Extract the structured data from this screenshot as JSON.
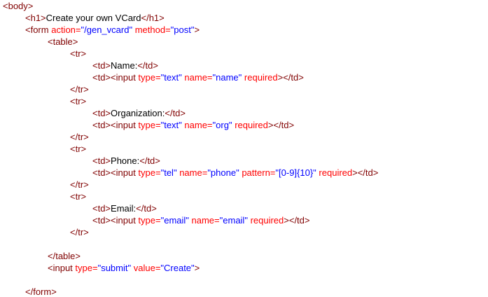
{
  "editor": {
    "lines": [
      {
        "indent": 0,
        "tokens": [
          {
            "t": "tag",
            "v": "<body>"
          }
        ]
      },
      {
        "indent": 1,
        "tokens": [
          {
            "t": "tag",
            "v": "<h1>"
          },
          {
            "t": "txt",
            "v": "Create your own VCard"
          },
          {
            "t": "tag",
            "v": "</h1>"
          }
        ]
      },
      {
        "indent": 1,
        "tokens": [
          {
            "t": "tag",
            "v": "<form "
          },
          {
            "t": "attr",
            "v": "action="
          },
          {
            "t": "val",
            "v": "\"/gen_vcard\""
          },
          {
            "t": "tag",
            "v": " "
          },
          {
            "t": "attr",
            "v": "method="
          },
          {
            "t": "val",
            "v": "\"post\""
          },
          {
            "t": "tag",
            "v": ">"
          }
        ]
      },
      {
        "indent": 2,
        "tokens": [
          {
            "t": "tag",
            "v": "<table>"
          }
        ]
      },
      {
        "indent": 3,
        "tokens": [
          {
            "t": "tag",
            "v": "<tr>"
          }
        ]
      },
      {
        "indent": 4,
        "tokens": [
          {
            "t": "tag",
            "v": "<td>"
          },
          {
            "t": "txt",
            "v": "Name:"
          },
          {
            "t": "tag",
            "v": "</td>"
          }
        ]
      },
      {
        "indent": 4,
        "tokens": [
          {
            "t": "tag",
            "v": "<td><input "
          },
          {
            "t": "attr",
            "v": "type="
          },
          {
            "t": "val",
            "v": "\"text\""
          },
          {
            "t": "tag",
            "v": " "
          },
          {
            "t": "attr",
            "v": "name="
          },
          {
            "t": "val",
            "v": "\"name\""
          },
          {
            "t": "tag",
            "v": " "
          },
          {
            "t": "attr",
            "v": "required"
          },
          {
            "t": "tag",
            "v": "></td>"
          }
        ]
      },
      {
        "indent": 3,
        "tokens": [
          {
            "t": "tag",
            "v": "</tr>"
          }
        ]
      },
      {
        "indent": 3,
        "tokens": [
          {
            "t": "tag",
            "v": "<tr>"
          }
        ]
      },
      {
        "indent": 4,
        "tokens": [
          {
            "t": "tag",
            "v": "<td>"
          },
          {
            "t": "txt",
            "v": "Organization:"
          },
          {
            "t": "tag",
            "v": "</td>"
          }
        ]
      },
      {
        "indent": 4,
        "tokens": [
          {
            "t": "tag",
            "v": "<td><input "
          },
          {
            "t": "attr",
            "v": "type="
          },
          {
            "t": "val",
            "v": "\"text\""
          },
          {
            "t": "tag",
            "v": " "
          },
          {
            "t": "attr",
            "v": "name="
          },
          {
            "t": "val",
            "v": "\"org\""
          },
          {
            "t": "tag",
            "v": " "
          },
          {
            "t": "attr",
            "v": "required"
          },
          {
            "t": "tag",
            "v": "></td>"
          }
        ]
      },
      {
        "indent": 3,
        "tokens": [
          {
            "t": "tag",
            "v": "</tr>"
          }
        ]
      },
      {
        "indent": 3,
        "tokens": [
          {
            "t": "tag",
            "v": "<tr>"
          }
        ]
      },
      {
        "indent": 4,
        "tokens": [
          {
            "t": "tag",
            "v": "<td>"
          },
          {
            "t": "txt",
            "v": "Phone:"
          },
          {
            "t": "tag",
            "v": "</td>"
          }
        ]
      },
      {
        "indent": 4,
        "tokens": [
          {
            "t": "tag",
            "v": "<td><input "
          },
          {
            "t": "attr",
            "v": "type="
          },
          {
            "t": "val",
            "v": "\"tel\""
          },
          {
            "t": "tag",
            "v": " "
          },
          {
            "t": "attr",
            "v": "name="
          },
          {
            "t": "val",
            "v": "\"phone\""
          },
          {
            "t": "tag",
            "v": " "
          },
          {
            "t": "attr",
            "v": "pattern="
          },
          {
            "t": "val",
            "v": "\"[0-9]{10}\""
          },
          {
            "t": "tag",
            "v": " "
          },
          {
            "t": "attr",
            "v": "required"
          },
          {
            "t": "tag",
            "v": "></td>"
          }
        ]
      },
      {
        "indent": 3,
        "tokens": [
          {
            "t": "tag",
            "v": "</tr>"
          }
        ]
      },
      {
        "indent": 3,
        "tokens": [
          {
            "t": "tag",
            "v": "<tr>"
          }
        ]
      },
      {
        "indent": 4,
        "tokens": [
          {
            "t": "tag",
            "v": "<td>"
          },
          {
            "t": "txt",
            "v": "Email:"
          },
          {
            "t": "tag",
            "v": "</td>"
          }
        ]
      },
      {
        "indent": 4,
        "tokens": [
          {
            "t": "tag",
            "v": "<td><input "
          },
          {
            "t": "attr",
            "v": "type="
          },
          {
            "t": "val",
            "v": "\"email\""
          },
          {
            "t": "tag",
            "v": " "
          },
          {
            "t": "attr",
            "v": "name="
          },
          {
            "t": "val",
            "v": "\"email\""
          },
          {
            "t": "tag",
            "v": " "
          },
          {
            "t": "attr",
            "v": "required"
          },
          {
            "t": "tag",
            "v": "></td>"
          }
        ]
      },
      {
        "indent": 3,
        "tokens": [
          {
            "t": "tag",
            "v": "</tr>"
          }
        ]
      },
      {
        "indent": 0,
        "tokens": []
      },
      {
        "indent": 2,
        "tokens": [
          {
            "t": "tag",
            "v": "</table>"
          }
        ]
      },
      {
        "indent": 2,
        "tokens": [
          {
            "t": "tag",
            "v": "<input "
          },
          {
            "t": "attr",
            "v": "type="
          },
          {
            "t": "val",
            "v": "\"submit\""
          },
          {
            "t": "tag",
            "v": " "
          },
          {
            "t": "attr",
            "v": "value="
          },
          {
            "t": "val",
            "v": "\"Create\""
          },
          {
            "t": "tag",
            "v": ">"
          }
        ]
      },
      {
        "indent": 0,
        "tokens": []
      },
      {
        "indent": 1,
        "tokens": [
          {
            "t": "tag",
            "v": "</form>"
          }
        ]
      }
    ]
  }
}
